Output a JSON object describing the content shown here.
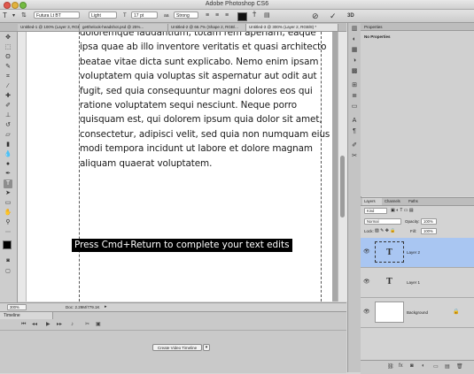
{
  "window": {
    "title": "Adobe Photoshop CS6"
  },
  "options_bar": {
    "font_family": "Futura Lt BT",
    "font_style": "Light",
    "font_size": "17 pt",
    "antialias": "Strong",
    "cancel_glyph": "⊘",
    "commit_glyph": "✓",
    "mode_3d": "3D"
  },
  "tabs": [
    {
      "label": "Untitled-1 @ 100% (Layer 3, RGB/8)",
      "active": false
    },
    {
      "label": "getthelook-headshot.psd @ 25%...",
      "active": false
    },
    {
      "label": "Untitled-2 @ 66.7% (Shape 2, RGB/...",
      "active": false
    },
    {
      "label": "Untitled-3 @ 300% (Layer 2, RGB/8) *",
      "active": true
    }
  ],
  "document": {
    "body_text": "doloremque laudantium, totam rem aperiam, eaque\nipsa quae ab illo inventore veritatis et quasi architecto\nbeatae vitae dicta sunt explicabo. Nemo enim ipsam\nvoluptatem quia voluptas sit aspernatur aut odit aut\nfugit, sed quia consequuntur magni dolores eos qui\nratione voluptatem sequi nesciunt. Neque porro\nquisquam est, qui dolorem ipsum quia dolor sit amet,\nconsectetur, adipisci velit, sed quia non numquam eius\nmodi tempora incidunt ut labore et dolore magnam\naliquam quaerat voluptatem.",
    "hint": "Press Cmd+Return to complete your text edits"
  },
  "status": {
    "zoom": "300%",
    "doc_size": "Doc: 2.29M/779.1K"
  },
  "timeline": {
    "title": "Timeline",
    "create_button": "Create Video Timeline"
  },
  "properties": {
    "tab": "Properties",
    "empty": "No Properties"
  },
  "layers_panel": {
    "tabs": [
      "Layers",
      "Channels",
      "Paths"
    ],
    "filter": "Kind",
    "blend_mode": "Normal",
    "opacity_label": "Opacity:",
    "opacity": "100%",
    "lock_label": "Lock:",
    "fill_label": "Fill:",
    "fill": "100%",
    "layers": [
      {
        "name": "Layer 2",
        "type": "text",
        "selected": true
      },
      {
        "name": "Layer 1",
        "type": "text",
        "selected": false
      },
      {
        "name": "Background",
        "type": "image",
        "selected": false
      }
    ]
  },
  "colors": {
    "selection": "#a9c6f2",
    "ui": "#d0d0d0"
  }
}
